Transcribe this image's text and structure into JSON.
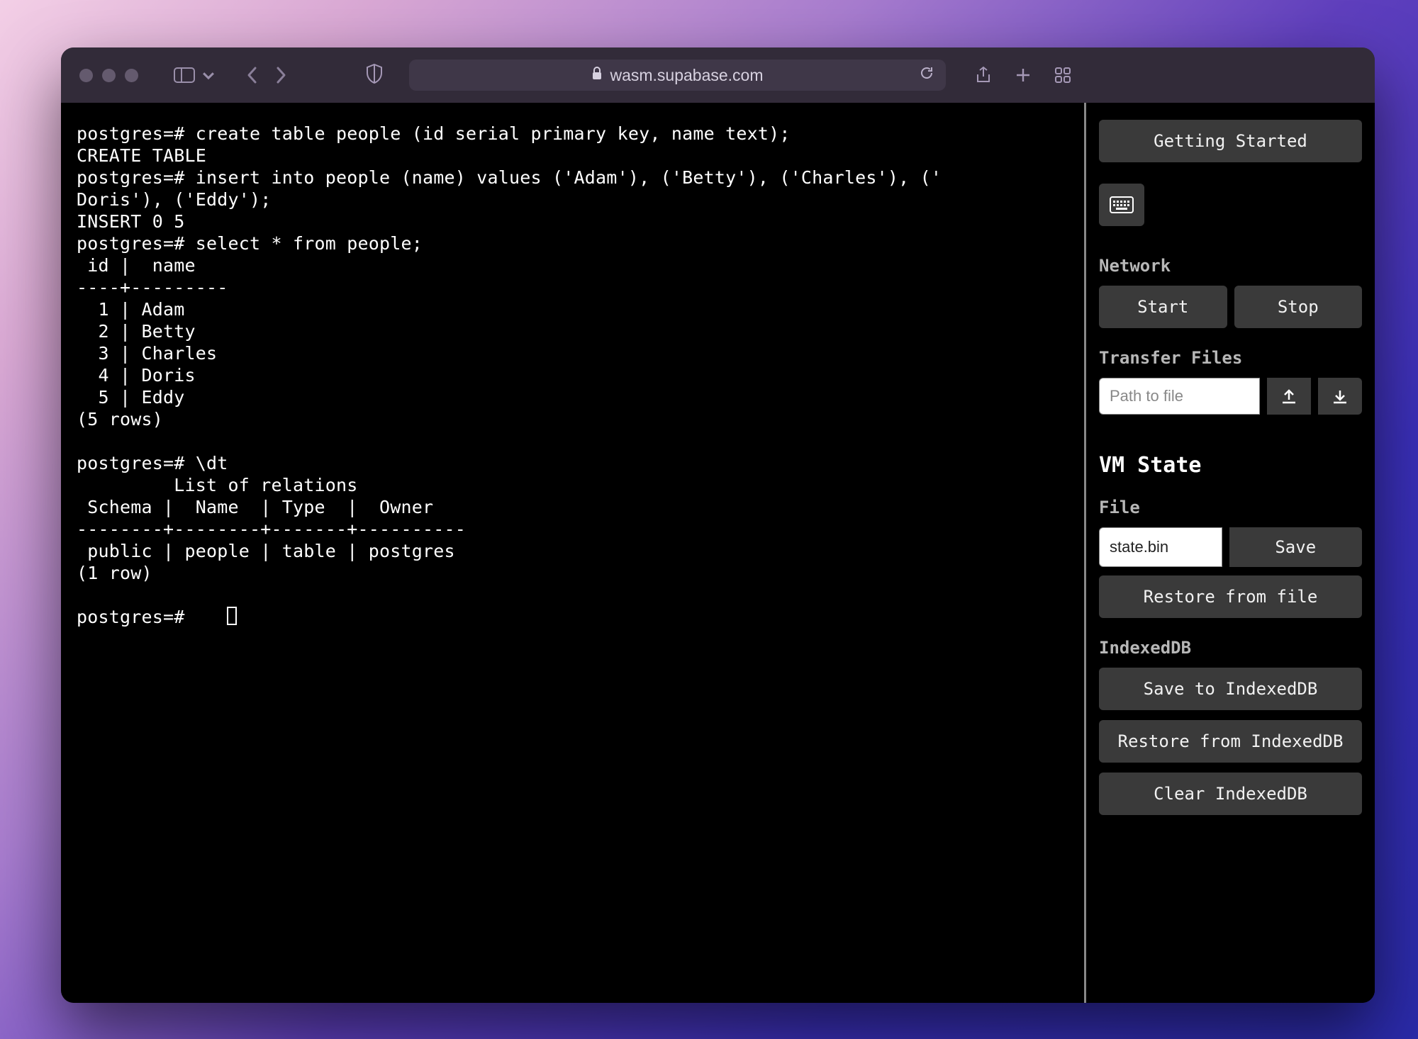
{
  "url": "wasm.supabase.com",
  "terminal": {
    "lines": "postgres=# create table people (id serial primary key, name text);\nCREATE TABLE\npostgres=# insert into people (name) values ('Adam'), ('Betty'), ('Charles'), ('\nDoris'), ('Eddy');\nINSERT 0 5\npostgres=# select * from people;\n id |  name   \n----+---------\n  1 | Adam\n  2 | Betty\n  3 | Charles\n  4 | Doris\n  5 | Eddy\n(5 rows)\n\npostgres=# \\dt\n         List of relations\n Schema |  Name  | Type  |  Owner   \n--------+--------+-------+----------\n public | people | table | postgres\n(1 row)\n",
    "prompt": "postgres=# "
  },
  "sidebar": {
    "getting_started": "Getting Started",
    "network_label": "Network",
    "start": "Start",
    "stop": "Stop",
    "transfer_label": "Transfer Files",
    "path_placeholder": "Path to file",
    "vm_state_heading": "VM State",
    "file_label": "File",
    "file_value": "state.bin",
    "save": "Save",
    "restore_file": "Restore from file",
    "indexeddb_label": "IndexedDB",
    "save_idb": "Save to IndexedDB",
    "restore_idb": "Restore from IndexedDB",
    "clear_idb": "Clear IndexedDB"
  }
}
